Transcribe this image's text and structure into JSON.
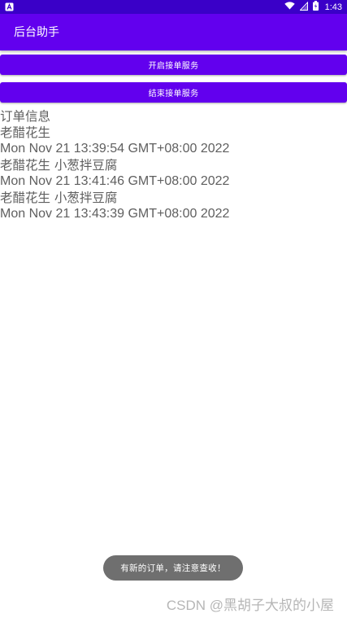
{
  "status_bar": {
    "time": "1:43",
    "left_icon": "notification-a-icon",
    "right_icons": [
      "wifi-icon",
      "signal-icon",
      "battery-icon"
    ]
  },
  "app_bar": {
    "title": "后台助手"
  },
  "buttons": {
    "start_label": "开启接单服务",
    "stop_label": "结束接单服务"
  },
  "orders": {
    "header": "订单信息",
    "entries": [
      {
        "items": "老醋花生",
        "time": "Mon Nov 21 13:39:54 GMT+08:00 2022"
      },
      {
        "items": "老醋花生  小葱拌豆腐",
        "time": "Mon Nov 21 13:41:46 GMT+08:00 2022"
      },
      {
        "items": "老醋花生  小葱拌豆腐",
        "time": "Mon Nov 21 13:43:39 GMT+08:00 2022"
      }
    ]
  },
  "toast": {
    "text": "有新的订单，请注意查收！"
  },
  "watermark": {
    "text": "CSDN @黑胡子大叔的小屋"
  },
  "colors": {
    "status_bar": "#3a00c8",
    "primary": "#6200ee",
    "text": "#5f5f5f",
    "toast_bg": "#6f6f6f",
    "watermark": "#b6b6b6"
  }
}
